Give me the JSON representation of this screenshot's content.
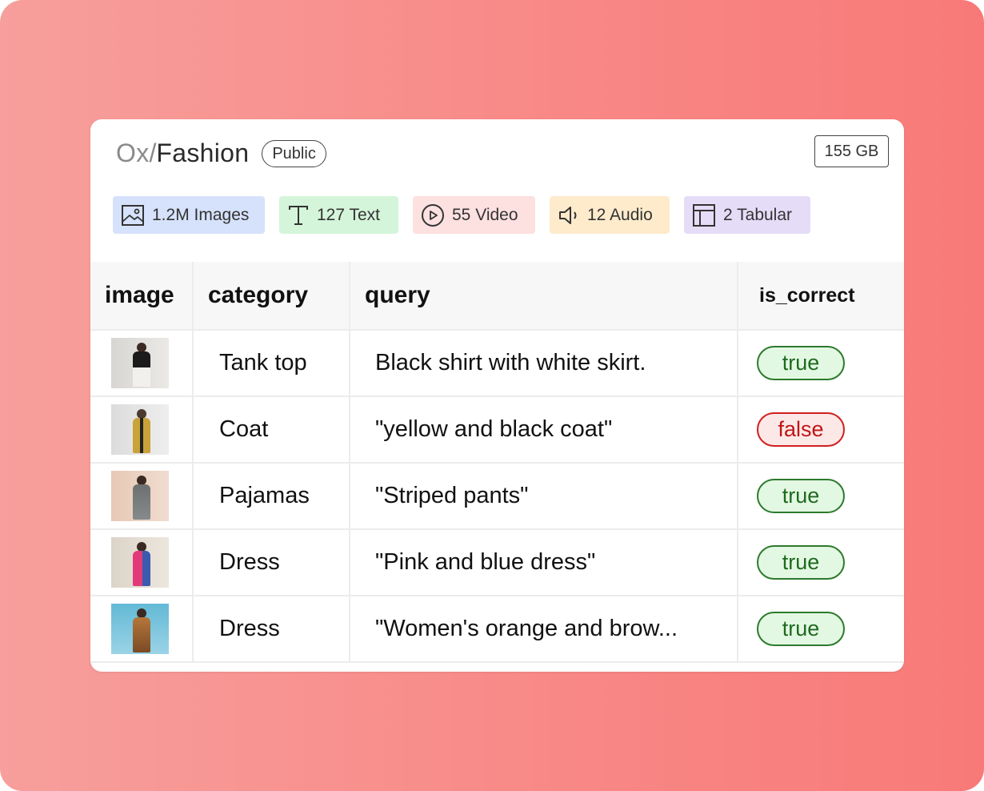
{
  "dataset": {
    "owner": "Ox",
    "separator": "/",
    "name": "Fashion",
    "visibility": "Public",
    "size": "155 GB"
  },
  "modalities": [
    {
      "label": "1.2M Images",
      "icon": "image-icon",
      "color": "#d6e2fb"
    },
    {
      "label": "127 Text",
      "icon": "text-icon",
      "color": "#d4f5d9"
    },
    {
      "label": "55 Video",
      "icon": "play-circle-icon",
      "color": "#fde0e0"
    },
    {
      "label": "12 Audio",
      "icon": "speaker-icon",
      "color": "#fdebcc"
    },
    {
      "label": "2 Tabular",
      "icon": "table-icon",
      "color": "#e5dcf8"
    }
  ],
  "table": {
    "columns": [
      "image",
      "category",
      "query",
      "is_correct"
    ],
    "rows": [
      {
        "image": "thumbnail-tank-top",
        "category": "Tank top",
        "query": "Black shirt with white skirt.",
        "is_correct": "true"
      },
      {
        "image": "thumbnail-coat",
        "category": "Coat",
        "query": "\"yellow and black coat\"",
        "is_correct": "false"
      },
      {
        "image": "thumbnail-pajamas",
        "category": "Pajamas",
        "query": "\"Striped pants\"",
        "is_correct": "true"
      },
      {
        "image": "thumbnail-dress-pink",
        "category": "Dress",
        "query": "\"Pink and blue dress\"",
        "is_correct": "true"
      },
      {
        "image": "thumbnail-dress-orange",
        "category": "Dress",
        "query": "\"Women's orange and brow...",
        "is_correct": "true"
      }
    ]
  },
  "colors": {
    "true_border": "#2d7a2d",
    "true_bg": "#e3f8e3",
    "false_border": "#d11f1f",
    "false_bg": "#fde8e8"
  }
}
